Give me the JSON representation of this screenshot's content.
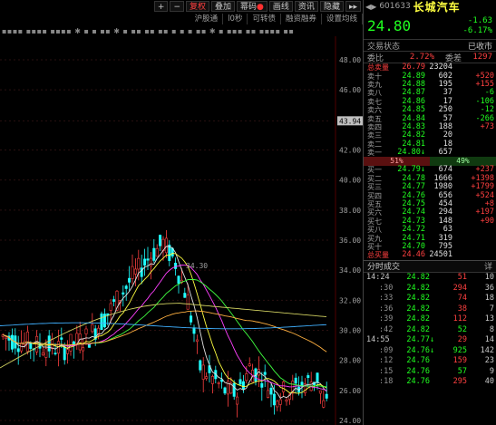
{
  "toolbar": {
    "plus": "+",
    "minus": "−",
    "fuquan": "复权",
    "overlay": "叠加",
    "remark": "幂码",
    "draw": "画线",
    "info": "资讯",
    "hide": "隐藏",
    "more": "▸▸"
  },
  "toolbar2": [
    "沪股通",
    "l0秒",
    "可转债",
    "融资融券",
    "设置均线"
  ],
  "indicator_stars": "▪▪▪▪ ▪▪▪▪ ▪▪▪▪ ✱ ▪ ▪ ▪▪ ✱ ▪    ▪▪ ▪▪ ▪▪ ▪    ▪  ▪  ▪▪ ✱ ▪ ▪▪▪ ▪▪ ▪▪▪▪ ▪▪",
  "y_axis": {
    "labels": [
      "48.00",
      "46.00",
      "43.94",
      "42.00",
      "40.00",
      "38.00",
      "36.00",
      "34.00",
      "32.00",
      "30.00",
      "28.00",
      "26.00",
      "24.00"
    ],
    "values": [
      48,
      46,
      43.94,
      42,
      40,
      38,
      36,
      34,
      32,
      30,
      28,
      26,
      24
    ],
    "highlight": "43.94",
    "ma_label": "34.30",
    "ma_value": 34.3
  },
  "colors": {
    "up": "#ff4040",
    "down": "#20ffff",
    "ma5": "#e0e0e0",
    "ma10": "#ffff40",
    "ma20": "#ff40ff",
    "ma30": "#40ff40",
    "ma60": "#ffb040",
    "ma120": "#40b0ff"
  },
  "stock": {
    "code": "601633",
    "name": "长城汽车",
    "price": "24.80",
    "change": "-1.63",
    "change_pct": "-6.17%"
  },
  "status": {
    "label": "交易状态",
    "value": "已收市"
  },
  "ratio_row": {
    "label1": "委比",
    "value1": "2.72%",
    "label2": "委差",
    "value2": "1297"
  },
  "sell_total": {
    "label": "总卖量",
    "price": "26.79",
    "vol": "23204"
  },
  "sells": [
    {
      "label": "卖十",
      "price": "24.89",
      "vol": "602",
      "delta": "+520",
      "dc": "r"
    },
    {
      "label": "卖九",
      "price": "24.88",
      "vol": "195",
      "delta": "+155",
      "dc": "r"
    },
    {
      "label": "卖八",
      "price": "24.87",
      "vol": "37",
      "delta": "-6",
      "dc": "g"
    },
    {
      "label": "卖七",
      "price": "24.86",
      "vol": "17",
      "delta": "-106",
      "dc": "g"
    },
    {
      "label": "卖六",
      "price": "24.85",
      "vol": "250",
      "delta": "-12",
      "dc": "g"
    },
    {
      "label": "卖五",
      "price": "24.84",
      "vol": "57",
      "delta": "-266",
      "dc": "g"
    },
    {
      "label": "卖四",
      "price": "24.83",
      "vol": "188",
      "delta": "+73",
      "dc": "r"
    },
    {
      "label": "卖三",
      "price": "24.82",
      "vol": "20",
      "delta": "",
      "dc": "w"
    },
    {
      "label": "卖二",
      "price": "24.81",
      "vol": "18",
      "delta": "",
      "dc": "w"
    },
    {
      "label": "卖一",
      "price": "24.80↓",
      "vol": "657",
      "delta": "",
      "dc": "w"
    }
  ],
  "bid_ask_ratio": {
    "buy": "51%",
    "sell": "49%"
  },
  "buys": [
    {
      "label": "买一",
      "price": "24.79↓",
      "vol": "674",
      "delta": "+237",
      "dc": "r"
    },
    {
      "label": "买二",
      "price": "24.78",
      "vol": "1666",
      "delta": "+1398",
      "dc": "r"
    },
    {
      "label": "买三",
      "price": "24.77",
      "vol": "1980",
      "delta": "+1799",
      "dc": "r"
    },
    {
      "label": "买四",
      "price": "24.76",
      "vol": "656",
      "delta": "+524",
      "dc": "r"
    },
    {
      "label": "买五",
      "price": "24.75",
      "vol": "454",
      "delta": "+8",
      "dc": "r"
    },
    {
      "label": "买六",
      "price": "24.74",
      "vol": "294",
      "delta": "+197",
      "dc": "r"
    },
    {
      "label": "买七",
      "price": "24.73",
      "vol": "148",
      "delta": "+90",
      "dc": "r"
    },
    {
      "label": "买八",
      "price": "24.72",
      "vol": "63",
      "delta": "",
      "dc": "w"
    },
    {
      "label": "买九",
      "price": "24.71",
      "vol": "319",
      "delta": "",
      "dc": "w"
    },
    {
      "label": "买十",
      "price": "24.70",
      "vol": "795",
      "delta": "",
      "dc": "w"
    }
  ],
  "buy_total": {
    "label": "总买量",
    "price": "24.46",
    "vol": "24501"
  },
  "ticks_header": {
    "title": "分时成交",
    "more": "详"
  },
  "ticks": [
    {
      "time": "14:24",
      "sub": false,
      "price": "24.82",
      "arrow": "",
      "vol": "51",
      "vc": "r",
      "n": "10"
    },
    {
      "time": ":30",
      "sub": true,
      "price": "24.82",
      "arrow": "",
      "vol": "294",
      "vc": "r",
      "n": "36"
    },
    {
      "time": ":33",
      "sub": true,
      "price": "24.82",
      "arrow": "",
      "vol": "74",
      "vc": "r",
      "n": "18"
    },
    {
      "time": ":36",
      "sub": true,
      "price": "24.82",
      "arrow": "",
      "vol": "38",
      "vc": "r",
      "n": "7"
    },
    {
      "time": ":39",
      "sub": true,
      "price": "24.82",
      "arrow": "",
      "vol": "112",
      "vc": "r",
      "n": "13"
    },
    {
      "time": ":42",
      "sub": true,
      "price": "24.82",
      "arrow": "",
      "vol": "52",
      "vc": "g",
      "n": "8"
    },
    {
      "time": "14:55",
      "sub": false,
      "price": "24.77",
      "arrow": "↓",
      "vol": "29",
      "vc": "r",
      "n": "14"
    },
    {
      "time": ":09",
      "sub": true,
      "price": "24.76",
      "arrow": "↓",
      "vol": "925",
      "vc": "g",
      "n": "142"
    },
    {
      "time": ":12",
      "sub": true,
      "price": "24.76",
      "arrow": "",
      "vol": "159",
      "vc": "r",
      "n": "23"
    },
    {
      "time": ":15",
      "sub": true,
      "price": "24.76",
      "arrow": "",
      "vol": "57",
      "vc": "g",
      "n": "9"
    },
    {
      "time": ":18",
      "sub": true,
      "price": "24.76",
      "arrow": "",
      "vol": "295",
      "vc": "r",
      "n": "40"
    }
  ]
}
